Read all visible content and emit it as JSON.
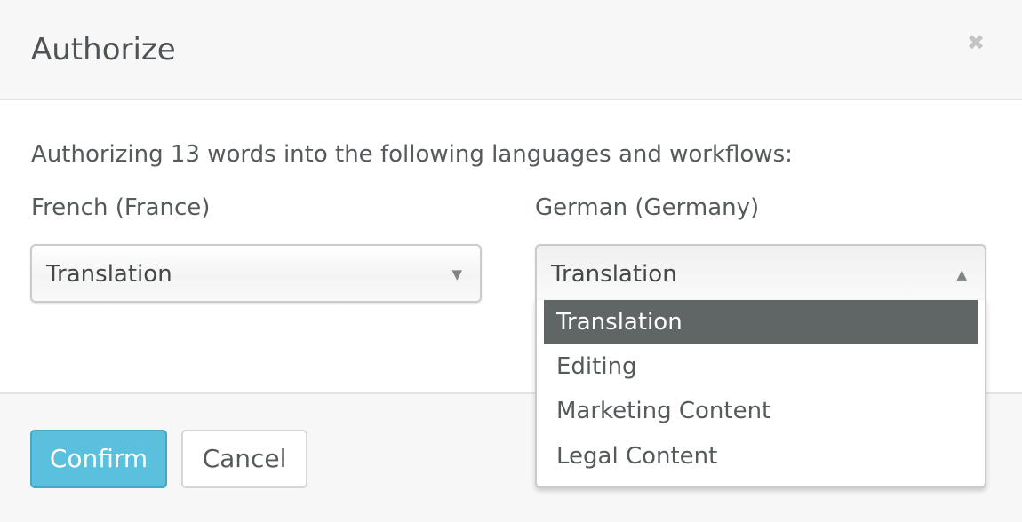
{
  "modal": {
    "title": "Authorize",
    "close_icon": "close-icon",
    "close_glyph": "✖"
  },
  "body": {
    "intro_text": "Authorizing 13 words into the following languages and workflows:",
    "languages": [
      {
        "label": "French (France)",
        "workflow": "Translation",
        "arrow": "▼",
        "open": false
      },
      {
        "label": "German (Germany)",
        "workflow": "Translation",
        "arrow": "▲",
        "open": true,
        "options": [
          "Translation",
          "Editing",
          "Marketing Content",
          "Legal Content"
        ],
        "highlighted_option": "Translation"
      }
    ]
  },
  "footer": {
    "confirm_label": "Confirm",
    "cancel_label": "Cancel"
  },
  "colors": {
    "confirm_button": "#5bc0de",
    "highlighted_option": "#606566"
  }
}
